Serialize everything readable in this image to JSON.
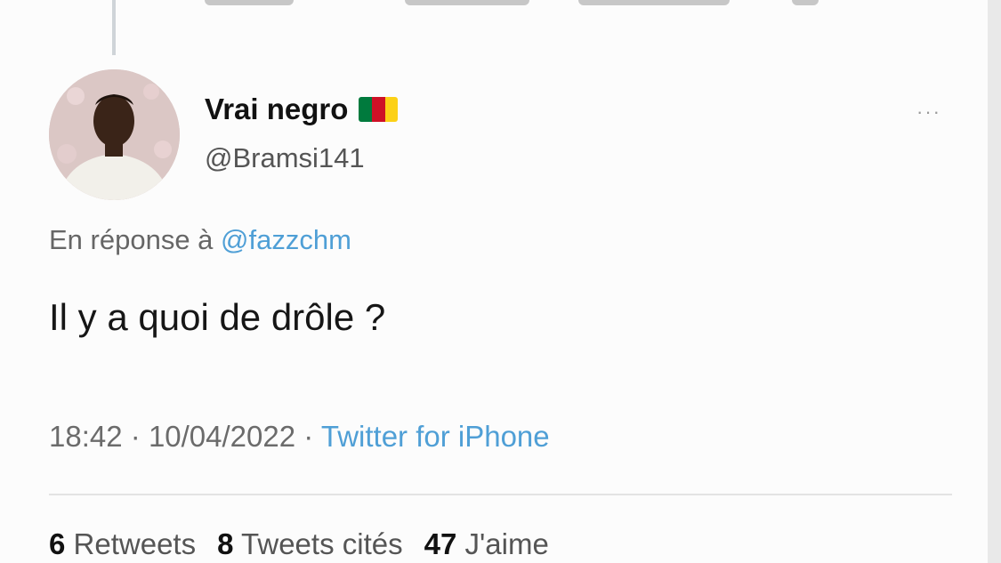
{
  "tweet": {
    "display_name": "Vrai negro",
    "flag": {
      "icon": "cameroon-flag-icon",
      "colors": [
        "#007a3d",
        "#ce1126",
        "#fcd116"
      ]
    },
    "handle": "@Bramsi141",
    "more_label": "···",
    "reply_prefix": "En réponse à",
    "reply_mention": "@fazzchm",
    "text": "Il y a quoi de drôle ?",
    "time": "18:42",
    "separator": "·",
    "date": "10/04/2022",
    "client": "Twitter for iPhone"
  },
  "stats": {
    "retweets_count": "6",
    "retweets_label": "Retweets",
    "quotes_count": "8",
    "quotes_label": "Tweets cités",
    "likes_count": "47",
    "likes_label": "J'aime"
  },
  "colors": {
    "accent": "#4f9fd6",
    "background": "#fcfcfc"
  }
}
